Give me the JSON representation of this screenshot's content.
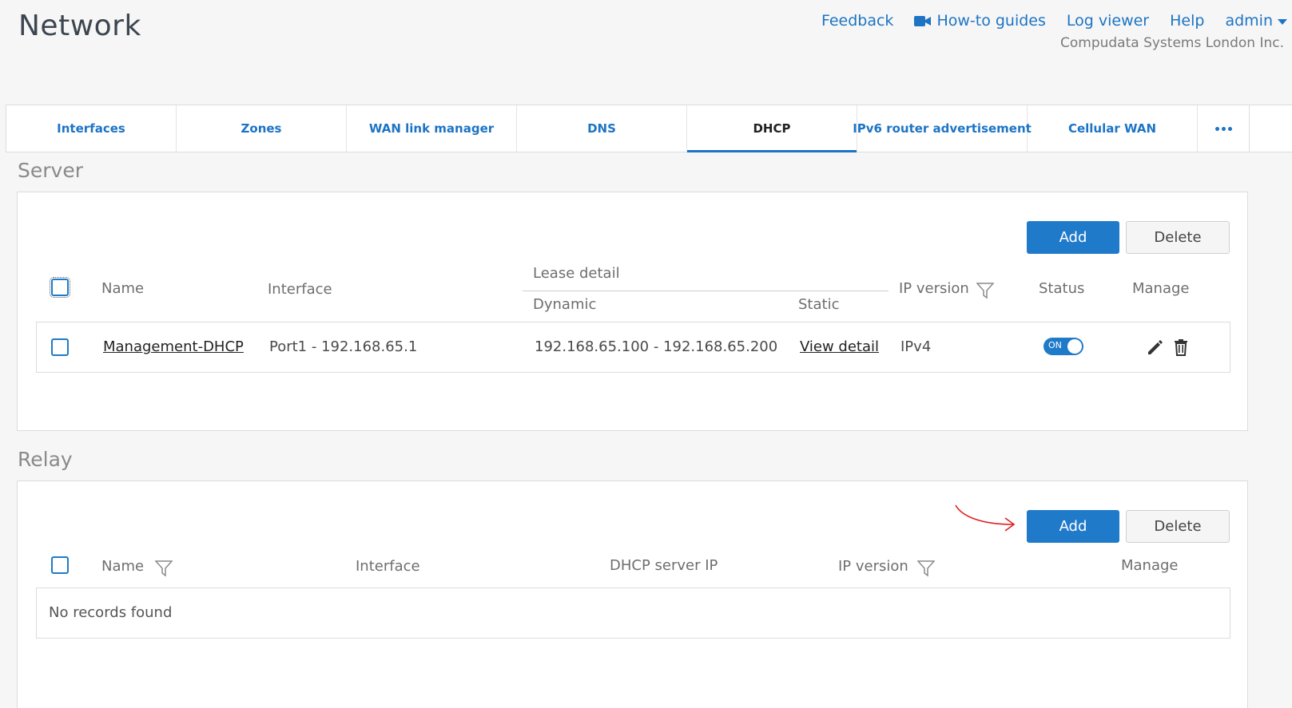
{
  "header": {
    "title": "Network",
    "links": {
      "feedback": "Feedback",
      "howto": "How-to guides",
      "log_viewer": "Log viewer",
      "help": "Help",
      "admin": "admin"
    },
    "company": "Compudata Systems London Inc."
  },
  "tabs": [
    {
      "label": "Interfaces"
    },
    {
      "label": "Zones"
    },
    {
      "label": "WAN link manager"
    },
    {
      "label": "DNS"
    },
    {
      "label": "DHCP",
      "active": true
    },
    {
      "label": "IPv6 router advertisement"
    },
    {
      "label": "Cellular WAN"
    }
  ],
  "server": {
    "title": "Server",
    "add_label": "Add",
    "delete_label": "Delete",
    "columns": {
      "name": "Name",
      "interface": "Interface",
      "lease_detail": "Lease detail",
      "dynamic": "Dynamic",
      "static": "Static",
      "ip_version": "IP version",
      "status": "Status",
      "manage": "Manage"
    },
    "rows": [
      {
        "name": "Management-DHCP",
        "interface": "Port1 - 192.168.65.1",
        "dynamic": "192.168.65.100 - 192.168.65.200",
        "static": "View detail",
        "ip_version": "IPv4",
        "status": "ON"
      }
    ]
  },
  "relay": {
    "title": "Relay",
    "add_label": "Add",
    "delete_label": "Delete",
    "columns": {
      "name": "Name",
      "interface": "Interface",
      "dhcp_server_ip": "DHCP server IP",
      "ip_version": "IP version",
      "manage": "Manage"
    },
    "empty_text": "No records found"
  },
  "colors": {
    "accent": "#1f7ac9",
    "annotation": "#e02020"
  }
}
